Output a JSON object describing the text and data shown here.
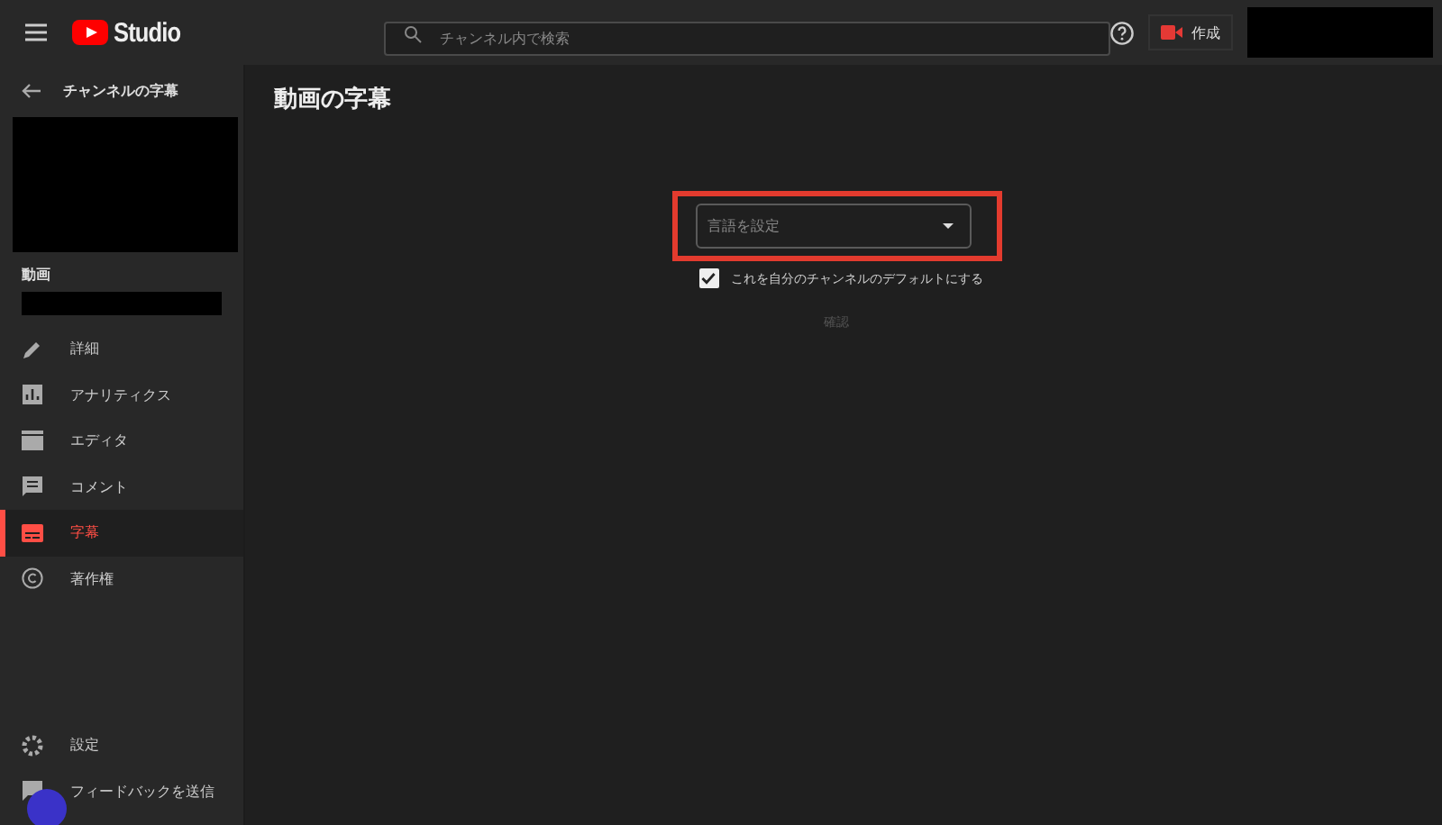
{
  "header": {
    "logo_text": "Studio",
    "search": {
      "placeholder": "チャンネル内で検索"
    },
    "create_button": "作成"
  },
  "sidebar": {
    "back_title": "チャンネルの字幕",
    "video_label": "動画",
    "items": [
      {
        "label": "詳細",
        "kind": "pencil",
        "selected": false
      },
      {
        "label": "アナリティクス",
        "kind": "chart",
        "selected": false
      },
      {
        "label": "エディタ",
        "kind": "clapper",
        "selected": false
      },
      {
        "label": "コメント",
        "kind": "comment",
        "selected": false
      },
      {
        "label": "字幕",
        "kind": "subtitles",
        "selected": true
      },
      {
        "label": "著作権",
        "kind": "copyright",
        "selected": false
      }
    ],
    "footer": [
      {
        "label": "設定",
        "kind": "gear"
      },
      {
        "label": "フィードバックを送信",
        "kind": "flag"
      }
    ]
  },
  "main": {
    "title": "動画の字幕",
    "language_select": {
      "placeholder": "言語を設定"
    },
    "default_checkbox": {
      "label": "これを自分のチャンネルのデフォルトにする",
      "checked": true
    },
    "confirm_button": {
      "label": "確認",
      "disabled": true
    }
  }
}
